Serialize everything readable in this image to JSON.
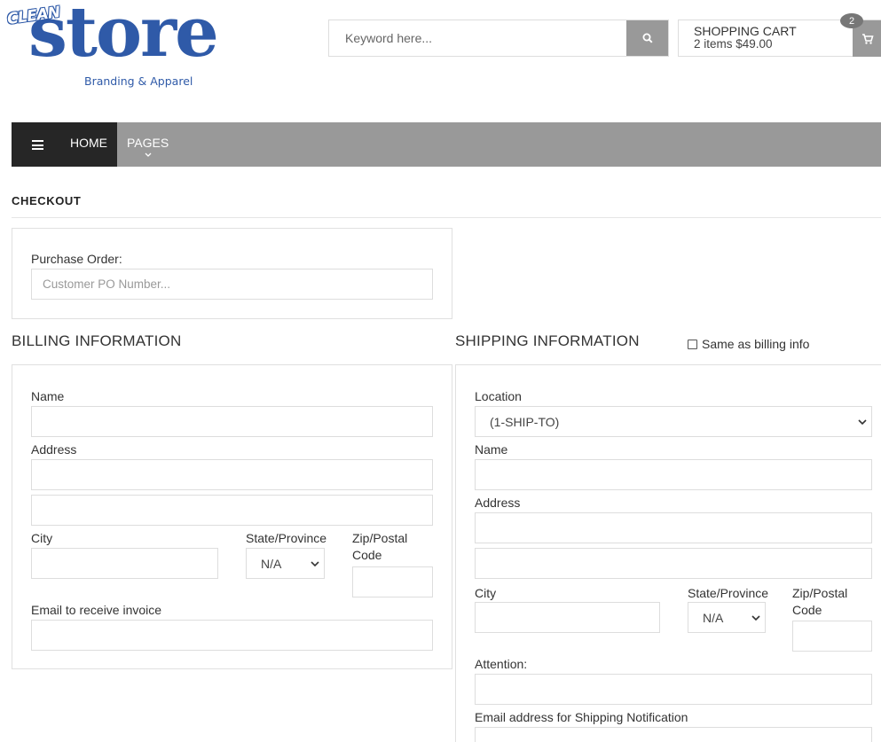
{
  "header": {
    "logo": {
      "top_text": "CLEAN",
      "main_text": "store",
      "tagline": "Branding & Apparel"
    },
    "search": {
      "placeholder": "Keyword here...",
      "button_icon": "search-icon"
    },
    "cart": {
      "title": "SHOPPING CART",
      "summary": "2 items $49.00",
      "badge_count": "2",
      "icon": "cart-icon"
    }
  },
  "nav": {
    "menu_icon": "hamburger-icon",
    "items": [
      {
        "label": "HOME"
      },
      {
        "label": "PAGES",
        "icon": "chevron-down-icon"
      }
    ]
  },
  "page_title": "CHECKOUT",
  "purchase_order": {
    "label": "Purchase Order:",
    "placeholder": "Customer PO Number..."
  },
  "billing": {
    "title": "BILLING INFORMATION",
    "name_label": "Name",
    "address_label": "Address",
    "city_label": "City",
    "state_label": "State/Province",
    "state_value": "N/A",
    "zip_label_1": "Zip/Postal",
    "zip_label_2": "Code",
    "email_label": "Email to receive invoice"
  },
  "shipping": {
    "title": "SHIPPING INFORMATION",
    "same_as_billing_label": "Same as billing info",
    "location_label": "Location",
    "location_value": "(1-SHIP-TO)",
    "name_label": "Name",
    "address_label": "Address",
    "city_label": "City",
    "state_label": "State/Province",
    "state_value": "N/A",
    "zip_label_1": "Zip/Postal",
    "zip_label_2": "Code",
    "attention_label": "Attention:",
    "email_label": "Email address for Shipping Notification"
  },
  "colors": {
    "brand_blue": "#2f5aa8",
    "nav_gray": "#999999",
    "nav_dark": "#262626"
  }
}
